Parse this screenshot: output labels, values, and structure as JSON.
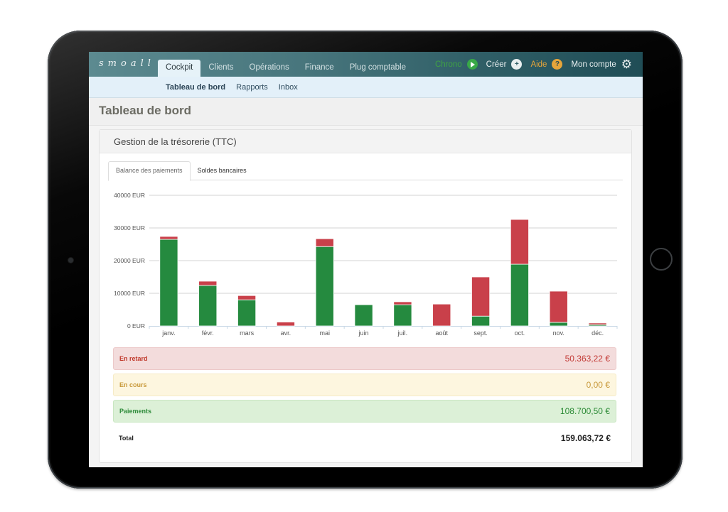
{
  "app": {
    "logo": "smoall"
  },
  "navbar": {
    "tabs": [
      {
        "label": "Cockpit",
        "active": true
      },
      {
        "label": "Clients",
        "active": false
      },
      {
        "label": "Opérations",
        "active": false
      },
      {
        "label": "Finance",
        "active": false
      },
      {
        "label": "Plug comptable",
        "active": false
      }
    ],
    "actions": {
      "chrono": {
        "label": "Chrono",
        "icon": "play-circle-icon",
        "color": "#38a847"
      },
      "creer": {
        "label": "Créer",
        "icon": "plus-circle-icon"
      },
      "aide": {
        "label": "Aide",
        "icon": "question-circle-icon",
        "color": "#e6a53a"
      },
      "compte": {
        "label": "Mon compte",
        "icon": "gear-icon"
      }
    }
  },
  "subnav": {
    "items": [
      {
        "label": "Tableau de bord",
        "active": true
      },
      {
        "label": "Rapports",
        "active": false
      },
      {
        "label": "Inbox",
        "active": false
      }
    ]
  },
  "page": {
    "title": "Tableau de bord"
  },
  "panel": {
    "title": "Gestion de la trésorerie (TTC)",
    "tabs": [
      {
        "label": "Balance des paiements",
        "active": true
      },
      {
        "label": "Soldes bancaires",
        "active": false
      }
    ]
  },
  "summary": {
    "late": {
      "label": "En retard",
      "amount": "50.363,22 €"
    },
    "in_progress": {
      "label": "En cours",
      "amount": "0,00 €"
    },
    "payments": {
      "label": "Paiements",
      "amount": "108.700,50 €"
    },
    "total": {
      "label": "Total",
      "amount": "159.063,72 €"
    }
  },
  "chart_data": {
    "type": "bar",
    "stacked": true,
    "title": "",
    "xlabel": "",
    "ylabel": "",
    "ylim": [
      0,
      40000
    ],
    "yticks": [
      0,
      10000,
      20000,
      30000,
      40000
    ],
    "ytick_labels": [
      "0 EUR",
      "10000 EUR",
      "20000 EUR",
      "30000 EUR",
      "40000 EUR"
    ],
    "grid": true,
    "categories": [
      "janv.",
      "févr.",
      "mars",
      "avr.",
      "mai",
      "juin",
      "juil.",
      "août",
      "sept.",
      "oct.",
      "nov.",
      "déc."
    ],
    "series": [
      {
        "name": "Paiements",
        "color": "#258a3f",
        "values": [
          26500,
          12400,
          8000,
          0,
          24300,
          6500,
          6500,
          0,
          3000,
          18900,
          1100,
          400
        ]
      },
      {
        "name": "En retard",
        "color": "#c9404a",
        "values": [
          900,
          1300,
          1300,
          1200,
          2400,
          0,
          900,
          6700,
          12000,
          13700,
          9550,
          500
        ]
      }
    ]
  }
}
